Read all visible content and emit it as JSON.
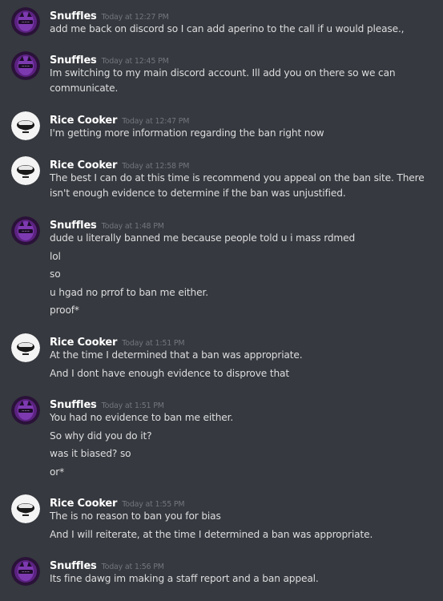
{
  "messages": [
    {
      "author": "Snuffles",
      "time": "Today at 12:27 PM",
      "lines": [
        "add me back on discord so I can add aperino to the call if u would please.,"
      ]
    },
    {
      "author": "Snuffles",
      "time": "Today at 12:45 PM",
      "lines": [
        "Im switching to my main discord account. Ill add you on there so we can communicate."
      ]
    },
    {
      "author": "Rice Cooker",
      "time": "Today at 12:47 PM",
      "lines": [
        "I'm getting more information regarding the ban right now"
      ]
    },
    {
      "author": "Rice Cooker",
      "time": "Today at 12:58 PM",
      "lines": [
        "The best I can do at this time is recommend you appeal on the ban site. There isn't enough evidence to determine if the ban was unjustified."
      ]
    },
    {
      "author": "Snuffles",
      "time": "Today at 1:48 PM",
      "lines": [
        "dude u literally banned me because people told u i mass rdmed",
        "lol",
        "so",
        "u hgad no prrof to ban me either.",
        "proof*"
      ]
    },
    {
      "author": "Rice Cooker",
      "time": "Today at 1:51 PM",
      "lines": [
        "At the time I determined that a ban was appropriate.",
        "And I dont have enough evidence to disprove that"
      ]
    },
    {
      "author": "Snuffles",
      "time": "Today at 1:51 PM",
      "lines": [
        "You had no evidence to ban me either.",
        "So why did you do it?",
        "was it biased? so",
        "or*"
      ]
    },
    {
      "author": "Rice Cooker",
      "time": "Today at 1:55 PM",
      "lines": [
        "The is no reason to ban you for bias",
        "And I will reiterate, at the time I determined a ban was appropriate."
      ]
    },
    {
      "author": "Snuffles",
      "time": "Today at 1:56 PM",
      "lines": [
        "Its fine dawg im making a staff report and a ban appeal."
      ]
    }
  ],
  "colors": {
    "background": "#36393f",
    "username": "#ffffff",
    "timestamp": "#72767d",
    "message_text": "#dcddde"
  }
}
